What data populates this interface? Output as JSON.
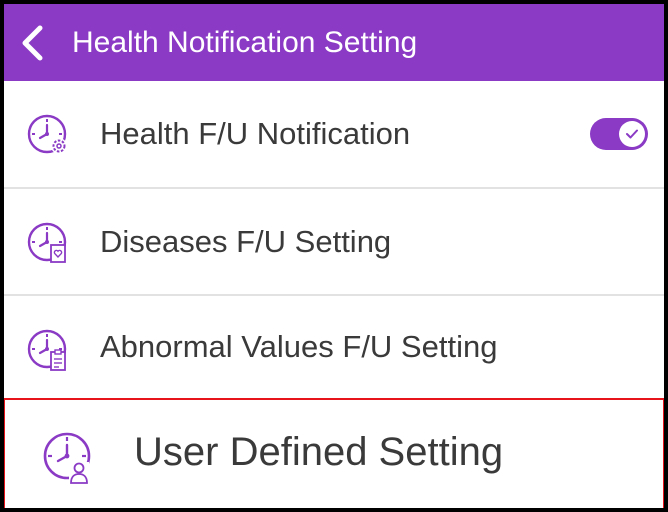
{
  "header": {
    "title": "Health Notification Setting",
    "background_color": "#8a3ac4",
    "back_icon": "chevron-left-icon"
  },
  "items": [
    {
      "label": "Health F/U Notification",
      "icon": "clock-gear-icon",
      "toggle": {
        "state": "on"
      }
    },
    {
      "label": "Diseases F/U Setting",
      "icon": "clock-document-heart-icon"
    },
    {
      "label": "Abnormal Values F/U Setting",
      "icon": "clock-clipboard-icon"
    },
    {
      "label": "User Defined Setting",
      "icon": "clock-user-icon",
      "highlighted": true
    }
  ],
  "accent_color": "#8a3ac4",
  "highlight_color": "#e8141b"
}
